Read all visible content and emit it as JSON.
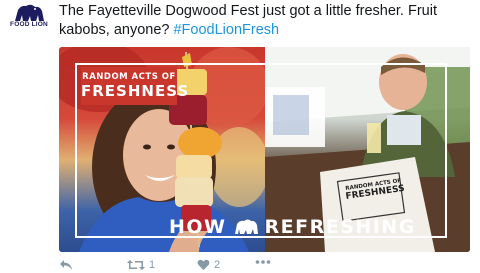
{
  "account": {
    "logo_text": "FOOD LION",
    "brand_color": "#1c1c5e"
  },
  "tweet": {
    "text_main": "The Fayetteville Dogwood Fest just got a little fresher. Fruit kabobs, anyone? ",
    "hashtag": "#FoodLionFresh",
    "hashtag_color": "#1b95e0"
  },
  "media": {
    "badge_line1": "RANDOM ACTS OF",
    "badge_line2": "FRESHNESS",
    "bag_line1": "RANDOM ACTS OF",
    "bag_line2": "FRESHNESS",
    "banner_left": "HOW",
    "banner_right": "REFRESHING",
    "badge_color": "#c8362c"
  },
  "actions": {
    "reply_icon": "reply-icon",
    "retweet_icon": "retweet-icon",
    "retweet_count": "1",
    "like_icon": "heart-icon",
    "like_count": "2",
    "more_icon": "more-icon",
    "icon_color": "#8899a6"
  }
}
